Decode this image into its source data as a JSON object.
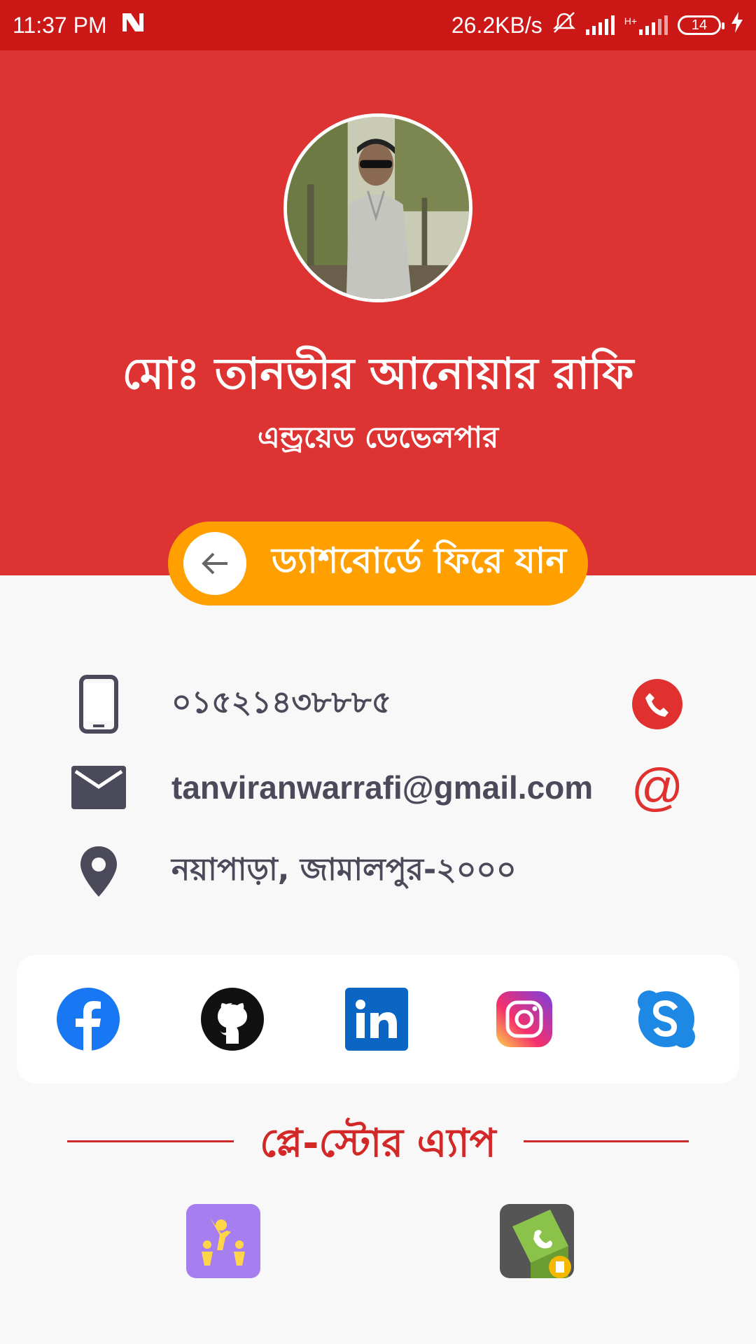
{
  "status_bar": {
    "time": "11:37 PM",
    "net_speed": "26.2KB/s",
    "battery": "14",
    "network_type": "H+"
  },
  "profile": {
    "name": "মোঃ তানভীর আনোয়ার রাফি",
    "role": "এন্ড্রয়েড ডেভেলপার",
    "back_button_label": "ড্যাশবোর্ডে ফিরে যান"
  },
  "contacts": [
    {
      "icon": "phone-icon",
      "value": "০১৫২১৪৩৮৮৮৫",
      "action": "call-icon"
    },
    {
      "icon": "mail-icon",
      "value": "tanviranwarrafi@gmail.com",
      "action": "at-icon"
    },
    {
      "icon": "location-icon",
      "value": "নয়াপাড়া, জামালপুর-২০০০"
    }
  ],
  "social": [
    "facebook-icon",
    "github-icon",
    "linkedin-icon",
    "instagram-icon",
    "skype-icon"
  ],
  "playstore": {
    "title": "প্লে-স্টোর এ্যাপ",
    "apps": [
      "family-app-icon",
      "contacts-app-icon"
    ]
  },
  "colors": {
    "status_bar": "#cc1717",
    "header": "#dd3333",
    "accent_orange": "#ff9f00",
    "text_dark": "#4a4a5a",
    "red_action": "#e03030"
  },
  "at_symbol": "@"
}
